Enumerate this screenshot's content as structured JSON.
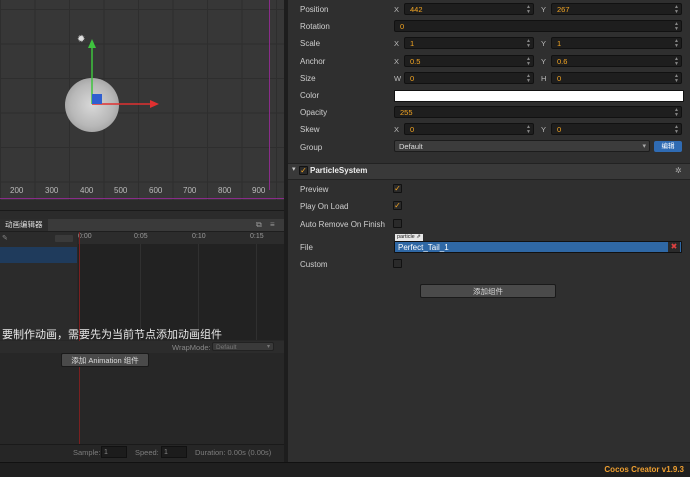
{
  "scene": {
    "ruler": [
      "200",
      "300",
      "400",
      "500",
      "600",
      "700",
      "800",
      "900"
    ],
    "light_icon": "sun-icon"
  },
  "anim_editor": {
    "tab_label": "动画编辑器",
    "timeline_marks": [
      "0:00",
      "0:05",
      "0:10",
      "0:15"
    ],
    "message": "要制作动画，需要先为当前节点添加动画组件",
    "wrapmode_label": "WrapMode:",
    "wrapmode_value": "Default",
    "add_button": "添加 Animation 组件",
    "sample_label": "Sample:",
    "sample_value": "1",
    "speed_label": "Speed:",
    "speed_value": "1",
    "duration": "Duration: 0.00s (0.00s)"
  },
  "inspector": {
    "position": {
      "label": "Position",
      "x": "442",
      "y": "267"
    },
    "rotation": {
      "label": "Rotation",
      "value": "0"
    },
    "scale": {
      "label": "Scale",
      "x": "1",
      "y": "1"
    },
    "anchor": {
      "label": "Anchor",
      "x": "0.5",
      "y": "0.6"
    },
    "size": {
      "label": "Size",
      "w": "0",
      "h": "0"
    },
    "color": {
      "label": "Color",
      "value": "#ffffff"
    },
    "opacity": {
      "label": "Opacity",
      "value": "255"
    },
    "skew": {
      "label": "Skew",
      "x": "0",
      "y": "0"
    },
    "group": {
      "label": "Group",
      "value": "Default",
      "edit": "编辑"
    },
    "axis": {
      "x": "X",
      "y": "Y",
      "w": "W",
      "h": "H"
    },
    "component": {
      "title": "ParticleSystem",
      "preview": "Preview",
      "play_on_load": "Play On Load",
      "auto_remove": "Auto Remove On Finish",
      "file_label": "File",
      "file_tag": "particle",
      "file_value": "Perfect_Tail_1",
      "custom": "Custom"
    },
    "add_component": "添加组件"
  },
  "status": {
    "version": "Cocos Creator v1.9.3"
  },
  "colors": {
    "accent": "#f5a623",
    "selection": "#2f68a5",
    "edit_button": "#2f6bb3",
    "version_text": "#f0a030"
  }
}
